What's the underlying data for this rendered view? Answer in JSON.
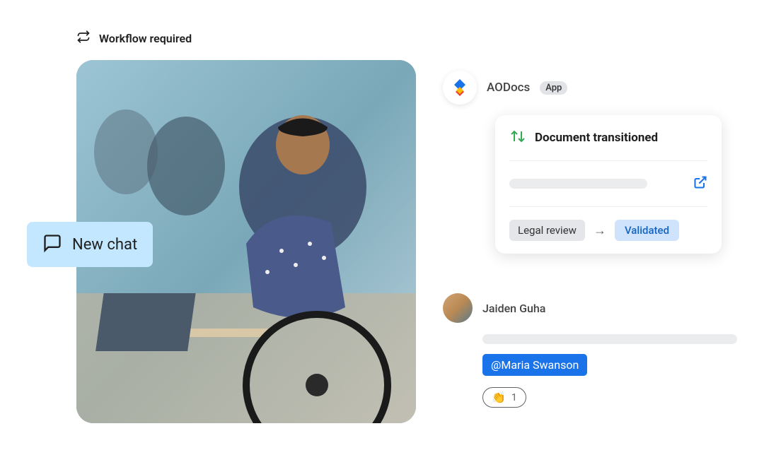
{
  "workflow": {
    "label": "Workflow required"
  },
  "newChat": {
    "label": "New chat"
  },
  "aodocs": {
    "name": "AODocs",
    "badge": "App"
  },
  "card": {
    "title": "Document transitioned",
    "statusFrom": "Legal review",
    "statusTo": "Validated"
  },
  "comment": {
    "userName": "Jaiden Guha",
    "mention": "@Maria Swanson",
    "reactionEmoji": "👏",
    "reactionCount": "1"
  }
}
